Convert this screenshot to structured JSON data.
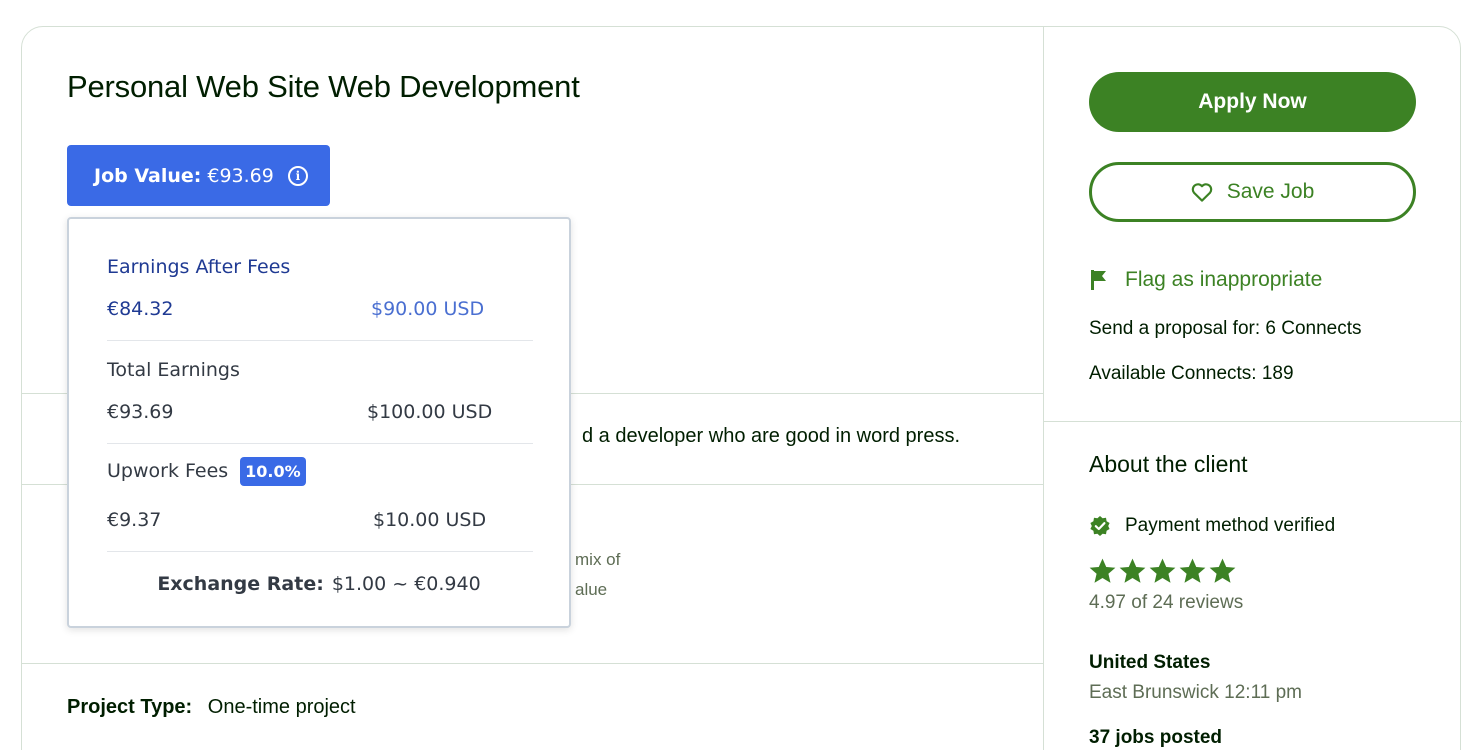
{
  "job": {
    "title": "Personal Web Site Web Development",
    "value_label": "Job Value:",
    "value_amount": "€93.69",
    "description_fragment": "d a developer who are good in word press.",
    "faded_line_1": "mix of",
    "faded_line_2": "alue",
    "project_type_label": "Project Type:",
    "project_type_value": "One-time project"
  },
  "popover": {
    "earnings_after_fees_label": "Earnings After Fees",
    "earnings_after_fees_eur": "€84.32",
    "earnings_after_fees_usd": "$90.00 USD",
    "total_earnings_label": "Total Earnings",
    "total_earnings_eur": "€93.69",
    "total_earnings_usd": "$100.00 USD",
    "upwork_fees_label": "Upwork Fees",
    "upwork_fees_percent": "10.0%",
    "upwork_fees_eur": "€9.37",
    "upwork_fees_usd": "$10.00 USD",
    "exchange_rate_label": "Exchange Rate:",
    "exchange_rate_value": "$1.00 ~ €0.940"
  },
  "sidebar": {
    "apply_label": "Apply Now",
    "save_label": "Save Job",
    "flag_label": "Flag as inappropriate",
    "proposal_cost": "Send a proposal for: 6 Connects",
    "available_connects": "Available Connects: 189"
  },
  "client": {
    "section_title": "About the client",
    "payment_status": "Payment method verified",
    "rating": 4.97,
    "rating_max": 5,
    "reviews_text": "4.97 of 24 reviews",
    "country": "United States",
    "city_time": "East Brunswick 12:11 pm",
    "jobs_posted": "37 jobs posted"
  },
  "colors": {
    "brand_green": "#3c8224",
    "accent_blue": "#3a6ae6",
    "text_dark": "#001e00",
    "text_muted": "#5e6d55"
  }
}
